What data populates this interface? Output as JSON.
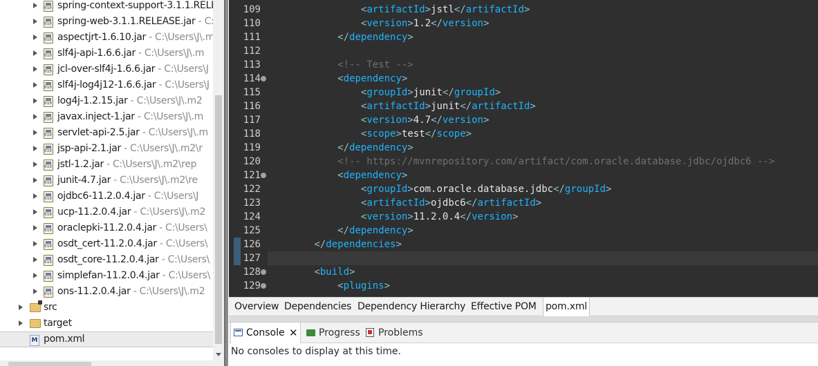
{
  "explorer": {
    "items": [
      {
        "name": "spring-context-support-3.1.1.RELE",
        "path": "",
        "type": "jar"
      },
      {
        "name": "spring-web-3.1.1.RELEASE.jar",
        "path": " - C:",
        "type": "jar"
      },
      {
        "name": "aspectjrt-1.6.10.jar",
        "path": " - C:\\Users\\J\\.m",
        "type": "jar"
      },
      {
        "name": "slf4j-api-1.6.6.jar",
        "path": " - C:\\Users\\J\\.m",
        "type": "jar"
      },
      {
        "name": "jcl-over-slf4j-1.6.6.jar",
        "path": " - C:\\Users\\J",
        "type": "jar"
      },
      {
        "name": "slf4j-log4j12-1.6.6.jar",
        "path": " - C:\\Users\\J",
        "type": "jar"
      },
      {
        "name": "log4j-1.2.15.jar",
        "path": " - C:\\Users\\J\\.m2",
        "type": "jar"
      },
      {
        "name": "javax.inject-1.jar",
        "path": " - C:\\Users\\J\\.m",
        "type": "jar"
      },
      {
        "name": "servlet-api-2.5.jar",
        "path": " - C:\\Users\\J\\.m",
        "type": "jar"
      },
      {
        "name": "jsp-api-2.1.jar",
        "path": " - C:\\Users\\J\\.m2\\r",
        "type": "jar"
      },
      {
        "name": "jstl-1.2.jar",
        "path": " - C:\\Users\\J\\.m2\\rep",
        "type": "jar"
      },
      {
        "name": "junit-4.7.jar",
        "path": " - C:\\Users\\J\\.m2\\re",
        "type": "jar"
      },
      {
        "name": "ojdbc6-11.2.0.4.jar",
        "path": " - C:\\Users\\J",
        "type": "jar"
      },
      {
        "name": "ucp-11.2.0.4.jar",
        "path": " - C:\\Users\\J\\.m2",
        "type": "jar"
      },
      {
        "name": "oraclepki-11.2.0.4.jar",
        "path": " - C:\\Users\\",
        "type": "jar"
      },
      {
        "name": "osdt_cert-11.2.0.4.jar",
        "path": " - C:\\Users\\",
        "type": "jar"
      },
      {
        "name": "osdt_core-11.2.0.4.jar",
        "path": " - C:\\Users\\",
        "type": "jar"
      },
      {
        "name": "simplefan-11.2.0.4.jar",
        "path": " - C:\\Users\\",
        "type": "jar"
      },
      {
        "name": "ons-11.2.0.4.jar",
        "path": " - C:\\Users\\J\\.m2",
        "type": "jar"
      },
      {
        "name": "src",
        "path": "",
        "type": "folder-src"
      },
      {
        "name": "target",
        "path": "",
        "type": "folder"
      },
      {
        "name": "pom.xml",
        "path": "",
        "type": "xml"
      }
    ]
  },
  "editor": {
    "lines": [
      {
        "n": "109",
        "fold": false,
        "mark": false,
        "tokens": [
          [
            "sp",
            "        "
          ],
          [
            "b",
            "<"
          ],
          [
            "t",
            "artifactId"
          ],
          [
            "b",
            ">"
          ],
          [
            "x",
            "jstl"
          ],
          [
            "b",
            "</"
          ],
          [
            "t",
            "artifactId"
          ],
          [
            "b",
            ">"
          ]
        ]
      },
      {
        "n": "110",
        "fold": false,
        "mark": false,
        "tokens": [
          [
            "sp",
            "        "
          ],
          [
            "b",
            "<"
          ],
          [
            "t",
            "version"
          ],
          [
            "b",
            ">"
          ],
          [
            "x",
            "1.2"
          ],
          [
            "b",
            "</"
          ],
          [
            "t",
            "version"
          ],
          [
            "b",
            ">"
          ]
        ]
      },
      {
        "n": "111",
        "fold": false,
        "mark": false,
        "tokens": [
          [
            "sp",
            "    "
          ],
          [
            "b",
            "</"
          ],
          [
            "t",
            "dependency"
          ],
          [
            "b",
            ">"
          ]
        ]
      },
      {
        "n": "112",
        "fold": false,
        "mark": false,
        "tokens": []
      },
      {
        "n": "113",
        "fold": false,
        "mark": false,
        "tokens": [
          [
            "sp",
            "    "
          ],
          [
            "c",
            "<!-- Test -->"
          ]
        ]
      },
      {
        "n": "114",
        "fold": true,
        "mark": false,
        "tokens": [
          [
            "sp",
            "    "
          ],
          [
            "b",
            "<"
          ],
          [
            "t",
            "dependency"
          ],
          [
            "b",
            ">"
          ]
        ]
      },
      {
        "n": "115",
        "fold": false,
        "mark": false,
        "tokens": [
          [
            "sp",
            "        "
          ],
          [
            "b",
            "<"
          ],
          [
            "t",
            "groupId"
          ],
          [
            "b",
            ">"
          ],
          [
            "x",
            "junit"
          ],
          [
            "b",
            "</"
          ],
          [
            "t",
            "groupId"
          ],
          [
            "b",
            ">"
          ]
        ]
      },
      {
        "n": "116",
        "fold": false,
        "mark": false,
        "tokens": [
          [
            "sp",
            "        "
          ],
          [
            "b",
            "<"
          ],
          [
            "t",
            "artifactId"
          ],
          [
            "b",
            ">"
          ],
          [
            "x",
            "junit"
          ],
          [
            "b",
            "</"
          ],
          [
            "t",
            "artifactId"
          ],
          [
            "b",
            ">"
          ]
        ]
      },
      {
        "n": "117",
        "fold": false,
        "mark": false,
        "tokens": [
          [
            "sp",
            "        "
          ],
          [
            "b",
            "<"
          ],
          [
            "t",
            "version"
          ],
          [
            "b",
            ">"
          ],
          [
            "x",
            "4.7"
          ],
          [
            "b",
            "</"
          ],
          [
            "t",
            "version"
          ],
          [
            "b",
            ">"
          ]
        ]
      },
      {
        "n": "118",
        "fold": false,
        "mark": false,
        "tokens": [
          [
            "sp",
            "        "
          ],
          [
            "b",
            "<"
          ],
          [
            "t",
            "scope"
          ],
          [
            "b",
            ">"
          ],
          [
            "x",
            "test"
          ],
          [
            "b",
            "</"
          ],
          [
            "t",
            "scope"
          ],
          [
            "b",
            ">"
          ]
        ]
      },
      {
        "n": "119",
        "fold": false,
        "mark": false,
        "tokens": [
          [
            "sp",
            "    "
          ],
          [
            "b",
            "</"
          ],
          [
            "t",
            "dependency"
          ],
          [
            "b",
            ">"
          ]
        ]
      },
      {
        "n": "120",
        "fold": false,
        "mark": false,
        "tokens": [
          [
            "sp",
            "    "
          ],
          [
            "c",
            "<!-- https://mvnrepository.com/artifact/com.oracle.database.jdbc/ojdbc6 -->"
          ]
        ]
      },
      {
        "n": "121",
        "fold": true,
        "mark": false,
        "tokens": [
          [
            "sp",
            "    "
          ],
          [
            "b",
            "<"
          ],
          [
            "t",
            "dependency"
          ],
          [
            "b",
            ">"
          ]
        ]
      },
      {
        "n": "122",
        "fold": false,
        "mark": false,
        "tokens": [
          [
            "sp",
            "        "
          ],
          [
            "b",
            "<"
          ],
          [
            "t",
            "groupId"
          ],
          [
            "b",
            ">"
          ],
          [
            "x",
            "com.oracle.database.jdbc"
          ],
          [
            "b",
            "</"
          ],
          [
            "t",
            "groupId"
          ],
          [
            "b",
            ">"
          ]
        ]
      },
      {
        "n": "123",
        "fold": false,
        "mark": false,
        "tokens": [
          [
            "sp",
            "        "
          ],
          [
            "b",
            "<"
          ],
          [
            "t",
            "artifactId"
          ],
          [
            "b",
            ">"
          ],
          [
            "x",
            "ojdbc6"
          ],
          [
            "b",
            "</"
          ],
          [
            "t",
            "artifactId"
          ],
          [
            "b",
            ">"
          ]
        ]
      },
      {
        "n": "124",
        "fold": false,
        "mark": false,
        "tokens": [
          [
            "sp",
            "        "
          ],
          [
            "b",
            "<"
          ],
          [
            "t",
            "version"
          ],
          [
            "b",
            ">"
          ],
          [
            "x",
            "11.2.0.4"
          ],
          [
            "b",
            "</"
          ],
          [
            "t",
            "version"
          ],
          [
            "b",
            ">"
          ]
        ]
      },
      {
        "n": "125",
        "fold": false,
        "mark": false,
        "tokens": [
          [
            "sp",
            "    "
          ],
          [
            "b",
            "</"
          ],
          [
            "t",
            "dependency"
          ],
          [
            "b",
            ">"
          ]
        ]
      },
      {
        "n": "126",
        "fold": false,
        "mark": true,
        "tokens": [
          [
            "b",
            "</"
          ],
          [
            "t",
            "dependencies"
          ],
          [
            "b",
            ">"
          ]
        ]
      },
      {
        "n": "127",
        "fold": false,
        "mark": true,
        "current": true,
        "tokens": []
      },
      {
        "n": "128",
        "fold": true,
        "mark": false,
        "tokens": [
          [
            "b",
            "<"
          ],
          [
            "t",
            "build"
          ],
          [
            "b",
            ">"
          ]
        ]
      },
      {
        "n": "129",
        "fold": true,
        "mark": false,
        "tokens": [
          [
            "sp",
            "    "
          ],
          [
            "b",
            "<"
          ],
          [
            "t",
            "plugins"
          ],
          [
            "b",
            ">"
          ]
        ]
      }
    ],
    "tabs": [
      "Overview",
      "Dependencies",
      "Dependency Hierarchy",
      "Effective POM",
      "pom.xml"
    ],
    "active_tab": "pom.xml"
  },
  "console": {
    "tabs": [
      {
        "label": "Console",
        "icon": "console-icon"
      },
      {
        "label": "Progress",
        "icon": "progress-icon"
      },
      {
        "label": "Problems",
        "icon": "problems-icon"
      }
    ],
    "close_glyph": "✕",
    "message": "No consoles to display at this time."
  }
}
